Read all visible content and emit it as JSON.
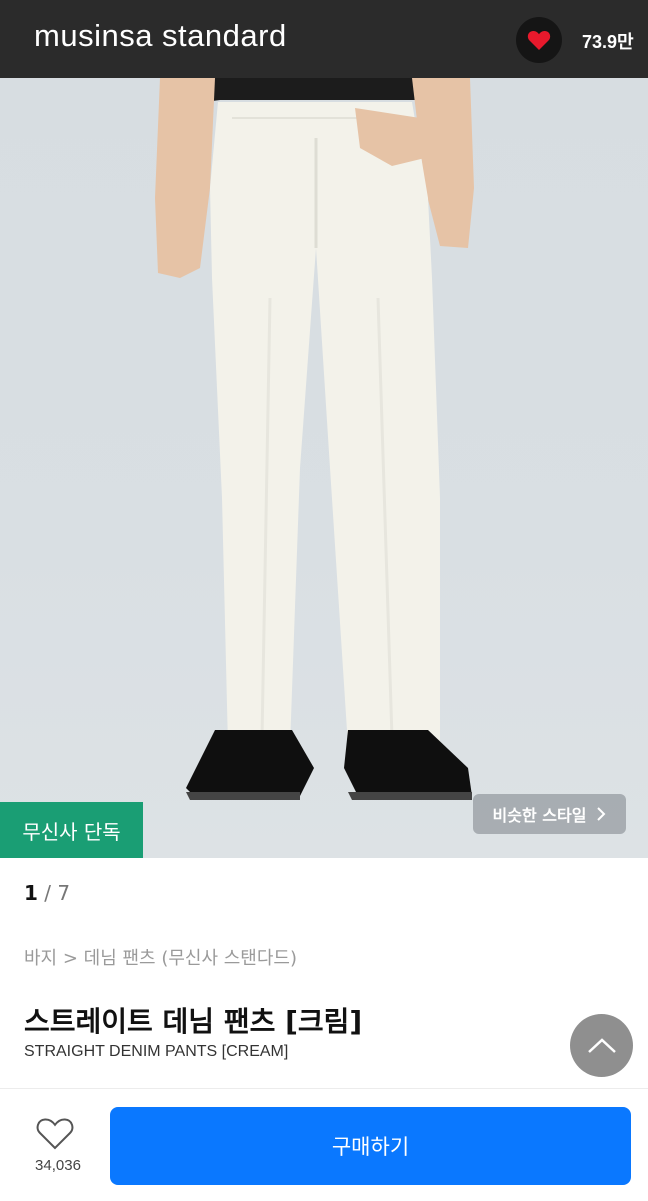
{
  "header": {
    "brand": "musinsa standard",
    "like_count": "73.9만"
  },
  "gallery": {
    "exclusive_badge": "무신사 단독",
    "similar_style_label": "비슷한 스타일",
    "current_page": "1",
    "page_separator": "/",
    "total_pages": "7"
  },
  "product": {
    "breadcrumb": "바지 > 데님 팬츠 (무신사 스탠다드)",
    "title_ko": "스트레이트 데님 팬츠 [크림]",
    "title_en": "STRAIGHT DENIM PANTS [CREAM]"
  },
  "bottom_bar": {
    "wish_count": "34,036",
    "buy_label": "구매하기"
  },
  "colors": {
    "header": "#2b2b2b",
    "heart": "#e8192c",
    "exclusive": "#1a9e74",
    "buy": "#0a78ff"
  },
  "icons": [
    "heart-icon",
    "chevron-right-icon",
    "arrow-up-icon",
    "heart-outline-icon"
  ]
}
